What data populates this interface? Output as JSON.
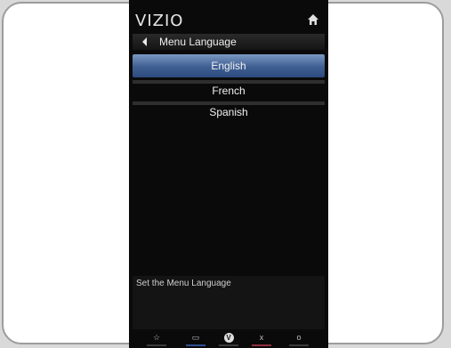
{
  "header": {
    "logo": "VIZIO",
    "home_icon": "home-icon"
  },
  "title_bar": {
    "back_icon": "back-arrow-icon",
    "title": "Menu Language"
  },
  "menu": {
    "items": [
      {
        "label": "English",
        "selected": true
      },
      {
        "label": "French",
        "selected": false
      },
      {
        "label": "Spanish",
        "selected": false
      }
    ]
  },
  "help": {
    "text": "Set the Menu Language"
  },
  "bottom_bar": {
    "buttons": [
      {
        "icon": "star-icon",
        "glyph": "☆",
        "underline": "#3a3a3a"
      },
      {
        "icon": "input-icon",
        "glyph": "▭",
        "underline": "#2f4f8f"
      },
      {
        "icon": "vizio-v-icon",
        "glyph": "V",
        "underline": "#3a3a3a"
      },
      {
        "icon": "close-icon",
        "glyph": "x",
        "underline": "#8f2f3f"
      },
      {
        "icon": "circle-icon",
        "glyph": "o",
        "underline": "#3a3a3a"
      }
    ]
  },
  "colors": {
    "selected_highlight": "#3f5f93",
    "screen_background": "#0a0a0a"
  }
}
